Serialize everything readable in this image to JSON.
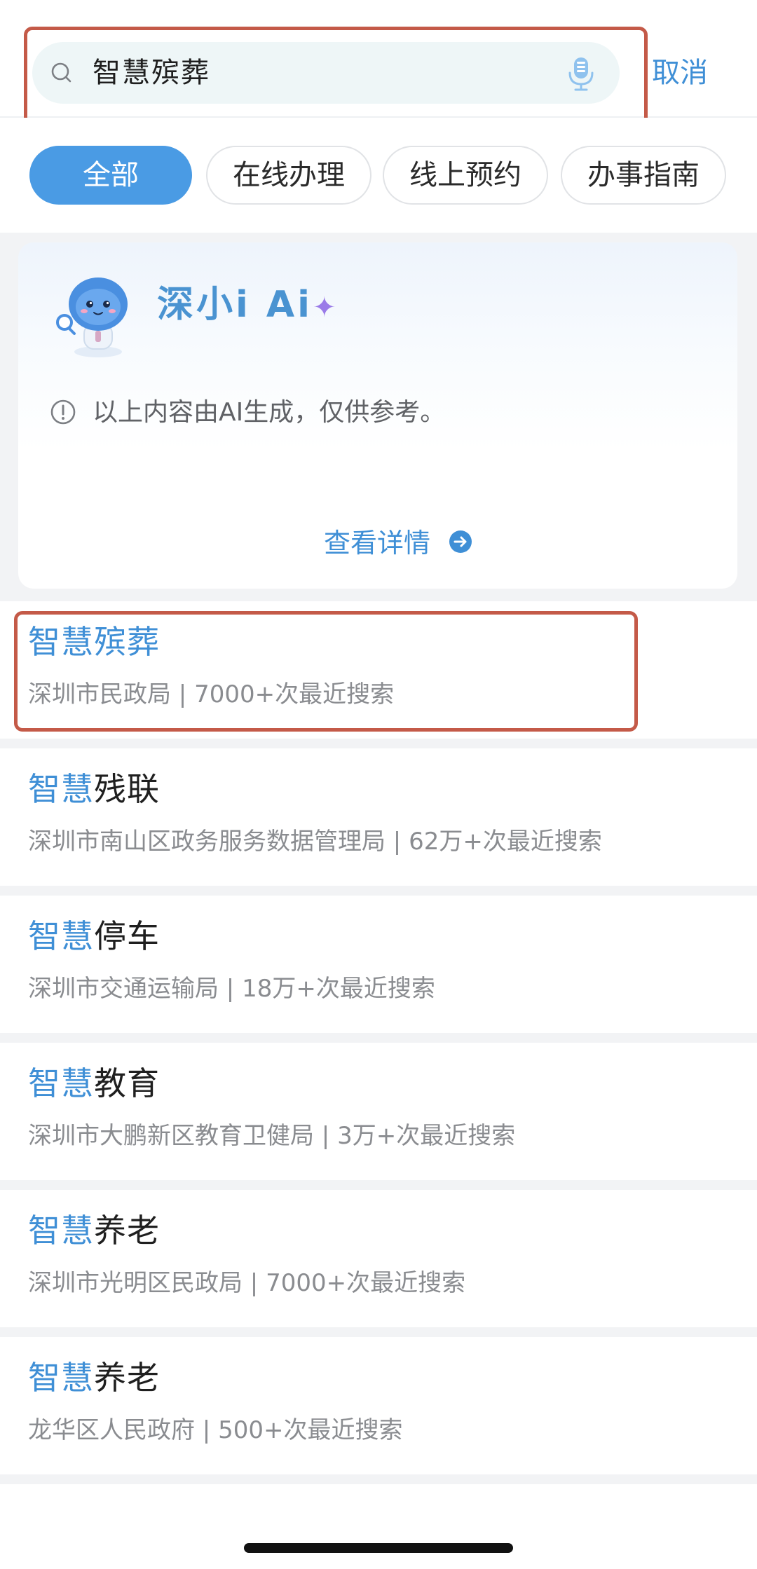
{
  "search": {
    "query": "智慧殡葬",
    "cancel_label": "取消"
  },
  "tabs": [
    {
      "label": "全部",
      "active": true
    },
    {
      "label": "在线办理",
      "active": false
    },
    {
      "label": "线上预约",
      "active": false
    },
    {
      "label": "办事指南",
      "active": false
    }
  ],
  "ai_card": {
    "brand": "深小i Ai",
    "brand_spark": "✦",
    "disclaimer": "以上内容由AI生成，仅供参考。",
    "details_label": "查看详情"
  },
  "results": [
    {
      "title_highlight": "智慧殡葬",
      "title_rest": "",
      "subtitle": "深圳市民政局 | 7000+次最近搜索"
    },
    {
      "title_highlight": "智慧",
      "title_rest": "残联",
      "subtitle": "深圳市南山区政务服务数据管理局 | 62万+次最近搜索"
    },
    {
      "title_highlight": "智慧",
      "title_rest": "停车",
      "subtitle": "深圳市交通运输局 | 18万+次最近搜索"
    },
    {
      "title_highlight": "智慧",
      "title_rest": "教育",
      "subtitle": "深圳市大鹏新区教育卫健局 | 3万+次最近搜索"
    },
    {
      "title_highlight": "智慧",
      "title_rest": "养老",
      "subtitle": "深圳市光明区民政局 | 7000+次最近搜索"
    },
    {
      "title_highlight": "智慧",
      "title_rest": "养老",
      "subtitle": "龙华区人民政府 | 500+次最近搜索"
    }
  ],
  "colors": {
    "accent": "#3f8fd6",
    "active_tab": "#4a9be4",
    "annotation_box": "#c45a48",
    "page_bg": "#f2f3f5"
  },
  "icons": [
    "search-icon",
    "microphone-icon",
    "robot-mascot-icon",
    "info-icon",
    "arrow-right-circle-icon"
  ]
}
